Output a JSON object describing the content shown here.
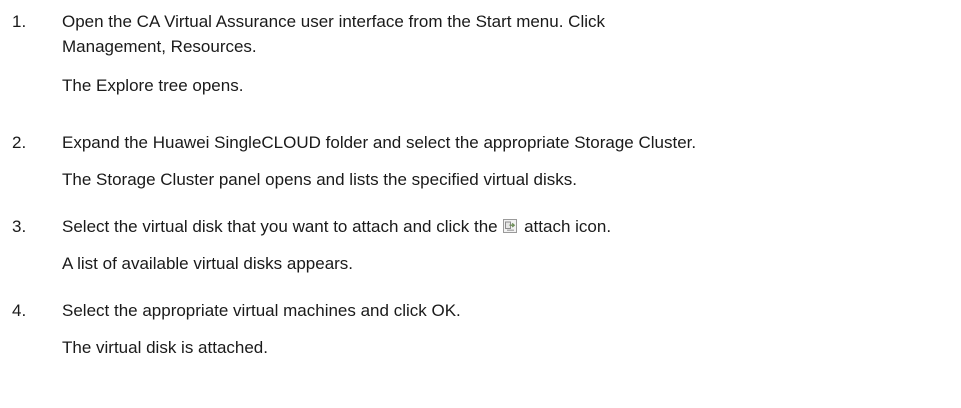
{
  "steps": [
    {
      "number": "1.",
      "line1": "Open the CA Virtual Assurance user interface from the Start menu. Click",
      "line2": "Management, Resources.",
      "result": "The Explore tree opens."
    },
    {
      "number": "2.",
      "line1": "Expand the Huawei SingleCLOUD folder and select the appropriate Storage Cluster.",
      "result": "The Storage Cluster panel opens and lists the specified virtual disks."
    },
    {
      "number": "3.",
      "text_before_icon": "Select the virtual disk that you want to attach and click the",
      "icon": "attach-icon",
      "text_after_icon": "attach icon.",
      "result": "A list of available virtual disks appears."
    },
    {
      "number": "4.",
      "line1": "Select the appropriate virtual machines and click OK.",
      "result": "The virtual disk is attached."
    }
  ]
}
